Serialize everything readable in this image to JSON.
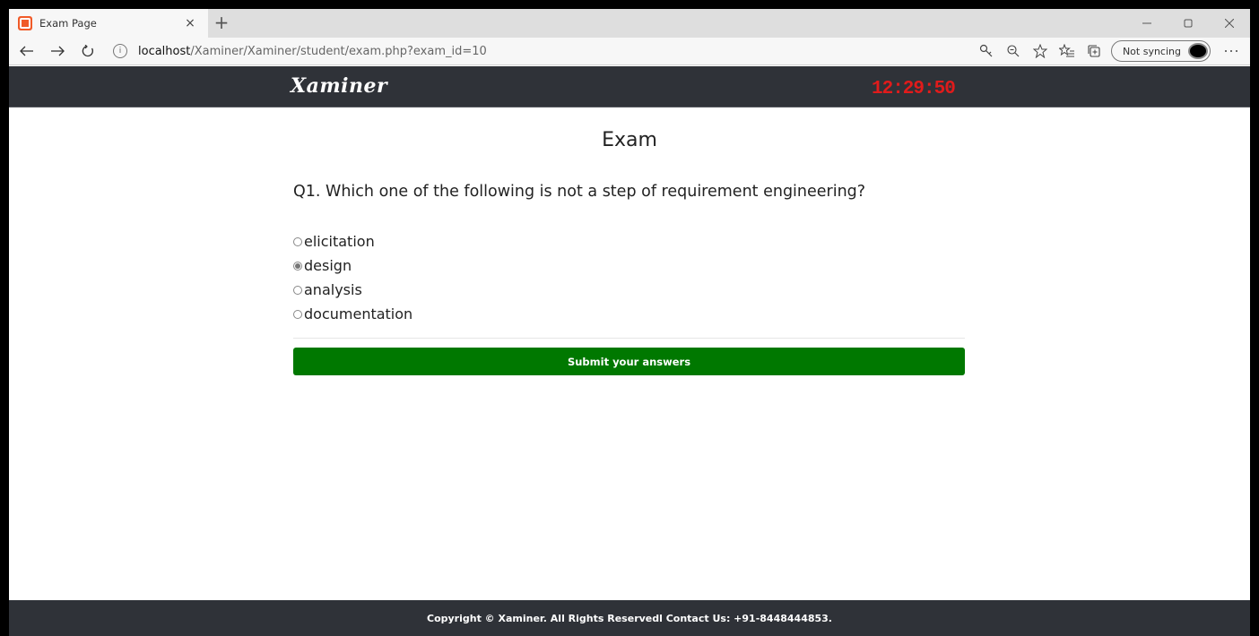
{
  "browser": {
    "tab_title": "Exam Page",
    "tab_close": "×",
    "new_tab": "+",
    "url_host": "localhost",
    "url_path": "/Xaminer/Xaminer/student/exam.php?exam_id=10",
    "sync_label": "Not syncing",
    "icons": [
      "back-icon",
      "forward-icon",
      "refresh-icon",
      "info-icon",
      "key-icon",
      "zoom-icon",
      "star-icon",
      "favorites-icon",
      "collections-icon",
      "more-icon"
    ]
  },
  "header": {
    "logo": "Xaminer",
    "timer": "12:29:50",
    "timer_color": "#e11b1b",
    "background": "#2f3238"
  },
  "exam": {
    "title": "Exam",
    "question": "Q1. Which one of the following is not a step of requirement engineering?",
    "options": [
      {
        "label": "elicitation",
        "selected": false
      },
      {
        "label": "design",
        "selected": true
      },
      {
        "label": "analysis",
        "selected": false
      },
      {
        "label": "documentation",
        "selected": false
      }
    ],
    "submit_label": "Submit your answers",
    "submit_color": "#007800"
  },
  "footer": {
    "text": "Copyright © Xaminer. All Rights Reservedl Contact Us: +91-8448444853."
  }
}
